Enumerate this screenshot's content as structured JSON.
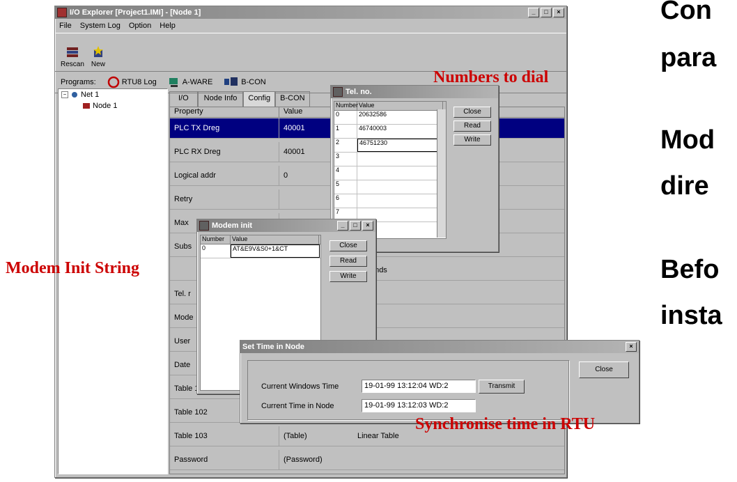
{
  "main_window": {
    "title": "I/O Explorer [Project1.IMI] - [Node 1]",
    "menu": [
      "File",
      "System Log",
      "Option",
      "Help"
    ],
    "toolbar": [
      "Rescan",
      "New"
    ],
    "programs_label": "Programs:",
    "programs": [
      "RTU8 Log",
      "A-WARE",
      "B-CON"
    ],
    "tree": {
      "net": "Net 1",
      "node": "Node 1"
    },
    "tabs": [
      "I/O",
      "Node Info",
      "Config",
      "B-CON"
    ],
    "columns": [
      "Property",
      "Value"
    ],
    "rows": [
      {
        "property": "PLC TX Dreg",
        "value": "40001",
        "extra": ""
      },
      {
        "property": "PLC RX Dreg",
        "value": "40001",
        "extra": ""
      },
      {
        "property": "Logical addr",
        "value": "0",
        "extra": ""
      },
      {
        "property": "Retry",
        "value": "",
        "extra": ""
      },
      {
        "property": "Max",
        "value": "",
        "extra": ""
      },
      {
        "property": "Subs",
        "value": "",
        "extra": ""
      },
      {
        "property": "",
        "value": "",
        "extra": "Seconds"
      },
      {
        "property": "Tel. r",
        "value": "",
        "extra": ""
      },
      {
        "property": "Mode",
        "value": "",
        "extra": ""
      },
      {
        "property": "User",
        "value": "",
        "extra": ""
      },
      {
        "property": "Date",
        "value": "",
        "extra": ""
      },
      {
        "property": "Table 101",
        "value": "",
        "extra": ""
      },
      {
        "property": "Table 102",
        "value": "",
        "extra": ""
      },
      {
        "property": "Table 103",
        "value": "(Table)",
        "extra": "Linear Table"
      },
      {
        "property": "Password",
        "value": "(Password)",
        "extra": ""
      }
    ]
  },
  "tel_window": {
    "title": "Tel. no.",
    "columns": [
      "Number",
      "Value"
    ],
    "rows": [
      {
        "n": "0",
        "v": "20632586"
      },
      {
        "n": "1",
        "v": "46740003"
      },
      {
        "n": "2",
        "v": "46751230"
      },
      {
        "n": "3",
        "v": ""
      },
      {
        "n": "4",
        "v": ""
      },
      {
        "n": "5",
        "v": ""
      },
      {
        "n": "6",
        "v": ""
      },
      {
        "n": "7",
        "v": ""
      }
    ],
    "buttons": [
      "Close",
      "Read",
      "Write"
    ]
  },
  "modem_window": {
    "title": "Modem init",
    "columns": [
      "Number",
      "Value"
    ],
    "rows": [
      {
        "n": "0",
        "v": "AT&E9V&S0+1&CT"
      }
    ],
    "buttons": [
      "Close",
      "Read",
      "Write"
    ]
  },
  "time_window": {
    "title": "Set Time in Node",
    "windows_time_label": "Current Windows Time",
    "windows_time_value": "19-01-99 13:12:04  WD:2",
    "node_time_label": "Current Time in Node",
    "node_time_value": "19-01-99 13:12:03  WD:2",
    "transmit_label": "Transmit",
    "close_label": "Close"
  },
  "annotations": {
    "numbers": "Numbers to dial",
    "modem": "Modem Init String",
    "sync": "Synchronise time in RTU"
  },
  "bullets": [
    "Con",
    "para",
    "Mod",
    "dire",
    "Befo",
    "insta"
  ]
}
